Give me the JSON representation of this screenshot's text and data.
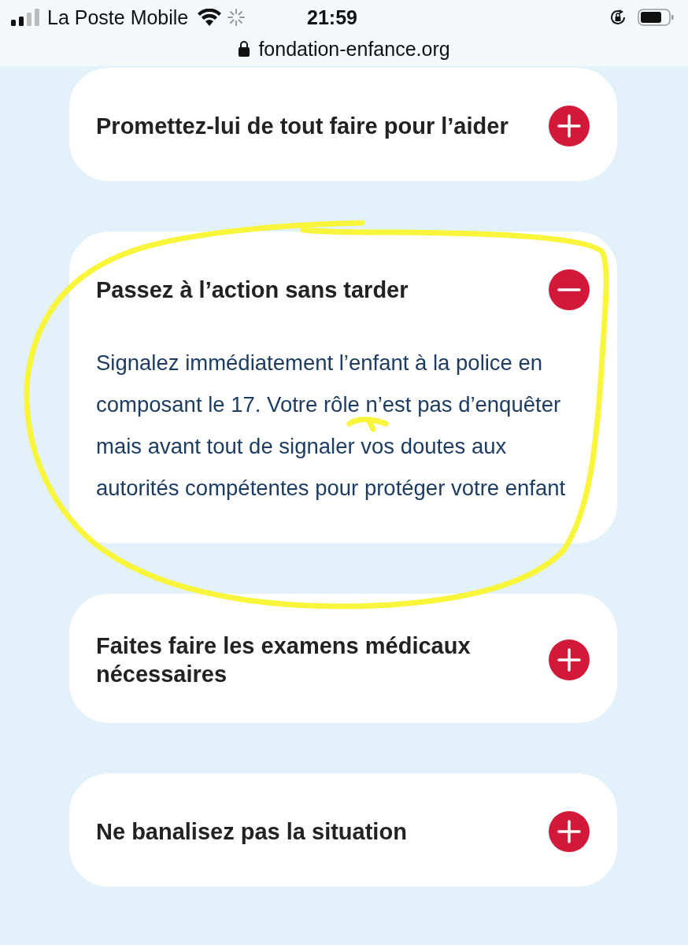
{
  "status_bar": {
    "carrier": "La Poste Mobile",
    "time": "21:59"
  },
  "address_bar": {
    "url": "fondation-enfance.org"
  },
  "accordion": [
    {
      "title": "Promettez-lui de tout faire pour l’aider",
      "expanded": false
    },
    {
      "title": "Passez à l’action sans tarder",
      "expanded": true,
      "body": "Signalez immédiatement l’enfant à la police en composant le 17. Votre rôle n’est pas d’enquêter mais avant tout de signaler vos doutes aux autorités compétentes pour protéger votre enfant"
    },
    {
      "title": "Faites faire les examens médicaux nécessaires",
      "expanded": false
    },
    {
      "title": "Ne banalisez pas la situation",
      "expanded": false
    }
  ]
}
